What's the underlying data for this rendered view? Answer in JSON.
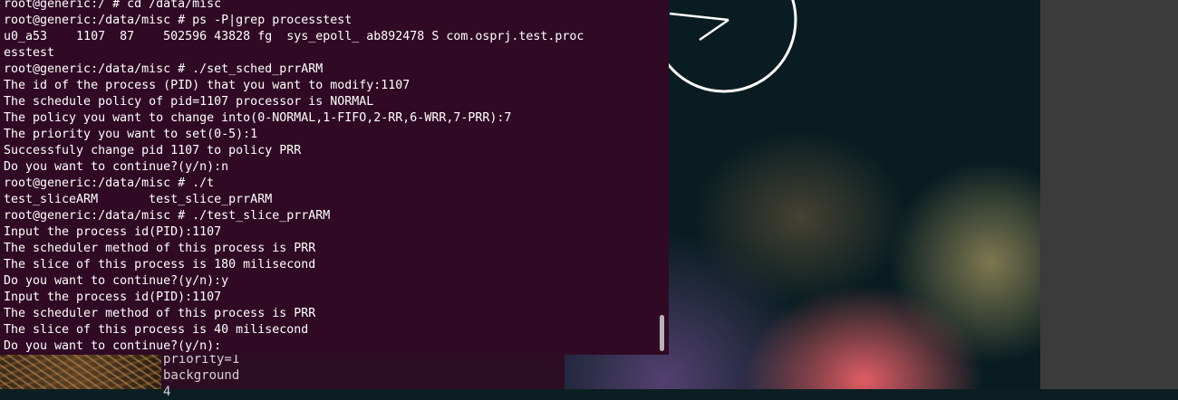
{
  "terminal": {
    "lines": [
      "root@generic:/ # cd /data/misc",
      "root@generic:/data/misc # ps -P|grep processtest",
      "u0_a53    1107  87    502596 43828 fg  sys_epoll_ ab892478 S com.osprj.test.proc",
      "esstest",
      "root@generic:/data/misc # ./set_sched_prrARM",
      "The id of the process (PID) that you want to modify:1107",
      "The schedule policy of pid=1107 processor is NORMAL",
      "The policy you want to change into(0-NORMAL,1-FIFO,2-RR,6-WRR,7-PRR):7",
      "The priority you want to set(0-5):1",
      "Successfuly change pid 1107 to policy PRR",
      "Do you want to continue?(y/n):n",
      "root@generic:/data/misc # ./t",
      "test_sliceARM       test_slice_prrARM",
      "root@generic:/data/misc # ./test_slice_prrARM",
      "Input the process id(PID):1107",
      "The scheduler method of this process is PRR",
      "The slice of this process is 180 milisecond",
      "Do you want to continue?(y/n):y",
      "Input the process id(PID):1107",
      "The scheduler method of this process is PRR",
      "The slice of this process is 40 milisecond",
      "Do you want to continue?(y/n):"
    ],
    "background_color": "#300a24",
    "text_color": "#ffffff"
  },
  "background_window": {
    "lines": [
      "priority=1",
      "background",
      "4"
    ]
  },
  "desktop": {
    "clock_icon": "analog-clock-icon"
  }
}
